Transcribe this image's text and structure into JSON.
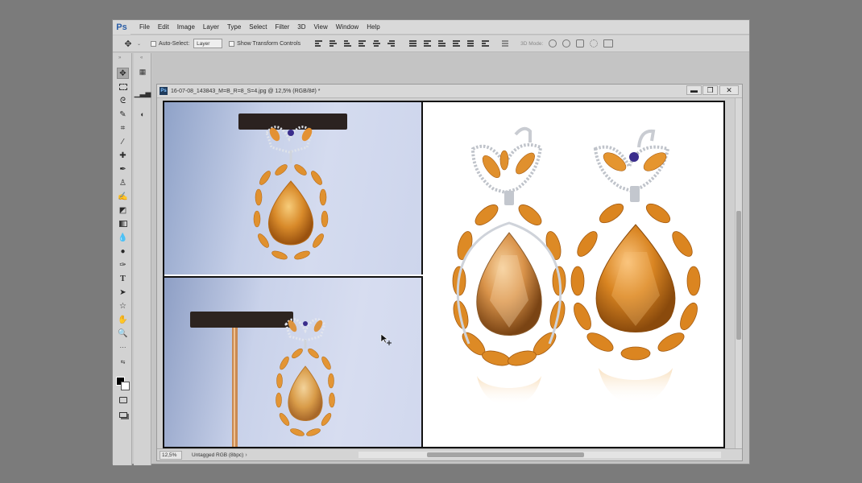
{
  "app": {
    "logo": "Ps",
    "menu": [
      "File",
      "Edit",
      "Image",
      "Layer",
      "Type",
      "Select",
      "Filter",
      "3D",
      "View",
      "Window",
      "Help"
    ]
  },
  "options": {
    "auto_select_label": "Auto-Select:",
    "auto_select_value": "Layer",
    "show_transform_label": "Show Transform Controls",
    "mode_3d_label": "3D Mode:"
  },
  "document": {
    "title": "16-07-08_143843_M=B_R=8_S=4.jpg @ 12,5% (RGB/8#) *",
    "zoom": "12,5%",
    "profile": "Untagged RGB (8bpc)",
    "minimize_label": "▬",
    "restore_label": "❐",
    "close_label": "✕"
  },
  "tools": [
    "move-tool-icon",
    "marquee-tool-icon",
    "lasso-tool-icon",
    "quick-select-tool-icon",
    "crop-tool-icon",
    "eyedropper-tool-icon",
    "healing-brush-icon",
    "brush-tool-icon",
    "clone-stamp-icon",
    "history-brush-icon",
    "eraser-tool-icon",
    "gradient-tool-icon",
    "blur-tool-icon",
    "dodge-tool-icon",
    "pen-tool-icon",
    "type-tool-icon",
    "path-select-icon",
    "shape-tool-icon",
    "hand-tool-icon",
    "zoom-tool-icon",
    "more-tools-icon"
  ],
  "colors": {
    "gold": "#d98a2b",
    "gold_dark": "#a85c12",
    "gold_light": "#f5b85a",
    "silver": "#c9ccd2",
    "amethyst": "#3a2d8c"
  }
}
